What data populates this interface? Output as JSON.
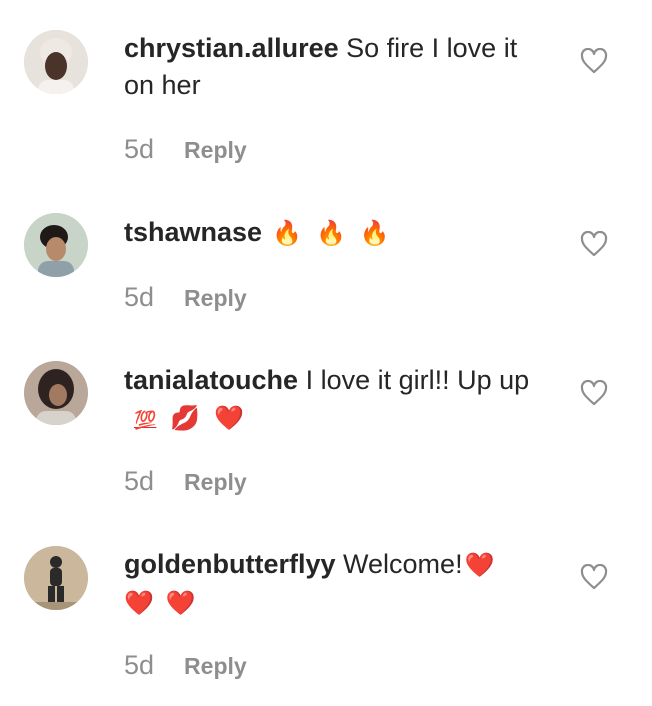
{
  "comments": [
    {
      "username": "chrystian.alluree",
      "text": "So fire I love it on her",
      "emojis": [],
      "time": "5d",
      "reply_label": "Reply",
      "avatar_colors": [
        "#e8e2dc",
        "#3a2a22"
      ]
    },
    {
      "username": "tshawnase",
      "text": "",
      "emojis": [
        "🔥",
        "🔥",
        "🔥"
      ],
      "time": "5d",
      "reply_label": "Reply",
      "avatar_colors": [
        "#c9d4c8",
        "#2a2320"
      ]
    },
    {
      "username": "tanialatouche",
      "text": "I love it girl!! Up up",
      "emojis": [
        "💯",
        "💋",
        "❤️"
      ],
      "time": "5d",
      "reply_label": "Reply",
      "avatar_colors": [
        "#b9a89a",
        "#2e2321"
      ]
    },
    {
      "username": "goldenbutterflyy",
      "text": "Welcome!",
      "emojis": [
        "❤️",
        "❤️",
        "❤️"
      ],
      "time": "5d",
      "reply_label": "Reply",
      "avatar_colors": [
        "#cbb79b",
        "#2a2a2a"
      ]
    }
  ],
  "icons": {
    "like": "heart-outline-icon"
  },
  "colors": {
    "text": "#262626",
    "muted": "#8e8e8e",
    "heart_red": "#e21b23"
  }
}
